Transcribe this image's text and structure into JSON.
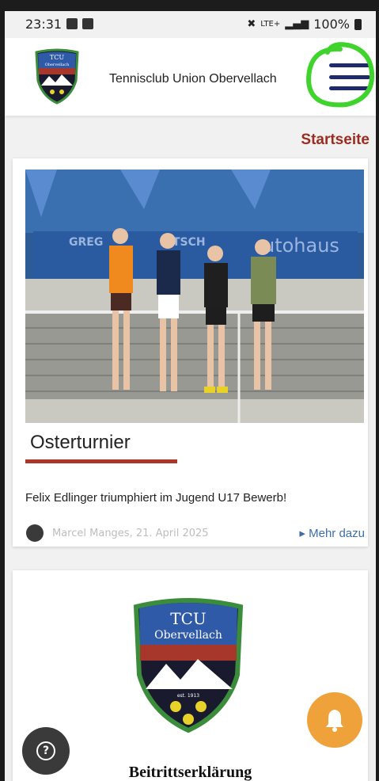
{
  "statusbar": {
    "time": "23:31",
    "network": "LTE+",
    "battery": "100%"
  },
  "header": {
    "logo_text_line1": "TCU",
    "logo_text_line2": "Obervellach",
    "site_title": "Tennisclub Union Obervellach",
    "menu_icon": "hamburger-menu-icon"
  },
  "breadcrumb": "Startseite",
  "article": {
    "title": "Osterturnier",
    "teaser": "Felix Edlinger triumphiert im Jugend U17 Bewerb!",
    "meta": "Marcel Manges, 21. April 2025",
    "more_link": "Mehr dazu",
    "banner_text_1": "GREG",
    "banner_text_2": "RITSCH",
    "banner_text_3": "utohaus"
  },
  "signup_card": {
    "logo_line1": "TCU",
    "logo_line2": "Obervellach",
    "logo_est": "est. 1913",
    "title": "Beitrittserklärung"
  },
  "floating": {
    "help_icon": "question-icon",
    "bell_icon": "bell-icon"
  },
  "colors": {
    "accent_red": "#9b2c20",
    "menu_blue": "#1f2a6b",
    "link_blue": "#3c6ea7",
    "bell_orange": "#f0a23a",
    "annotation_green": "#3fd42c"
  }
}
